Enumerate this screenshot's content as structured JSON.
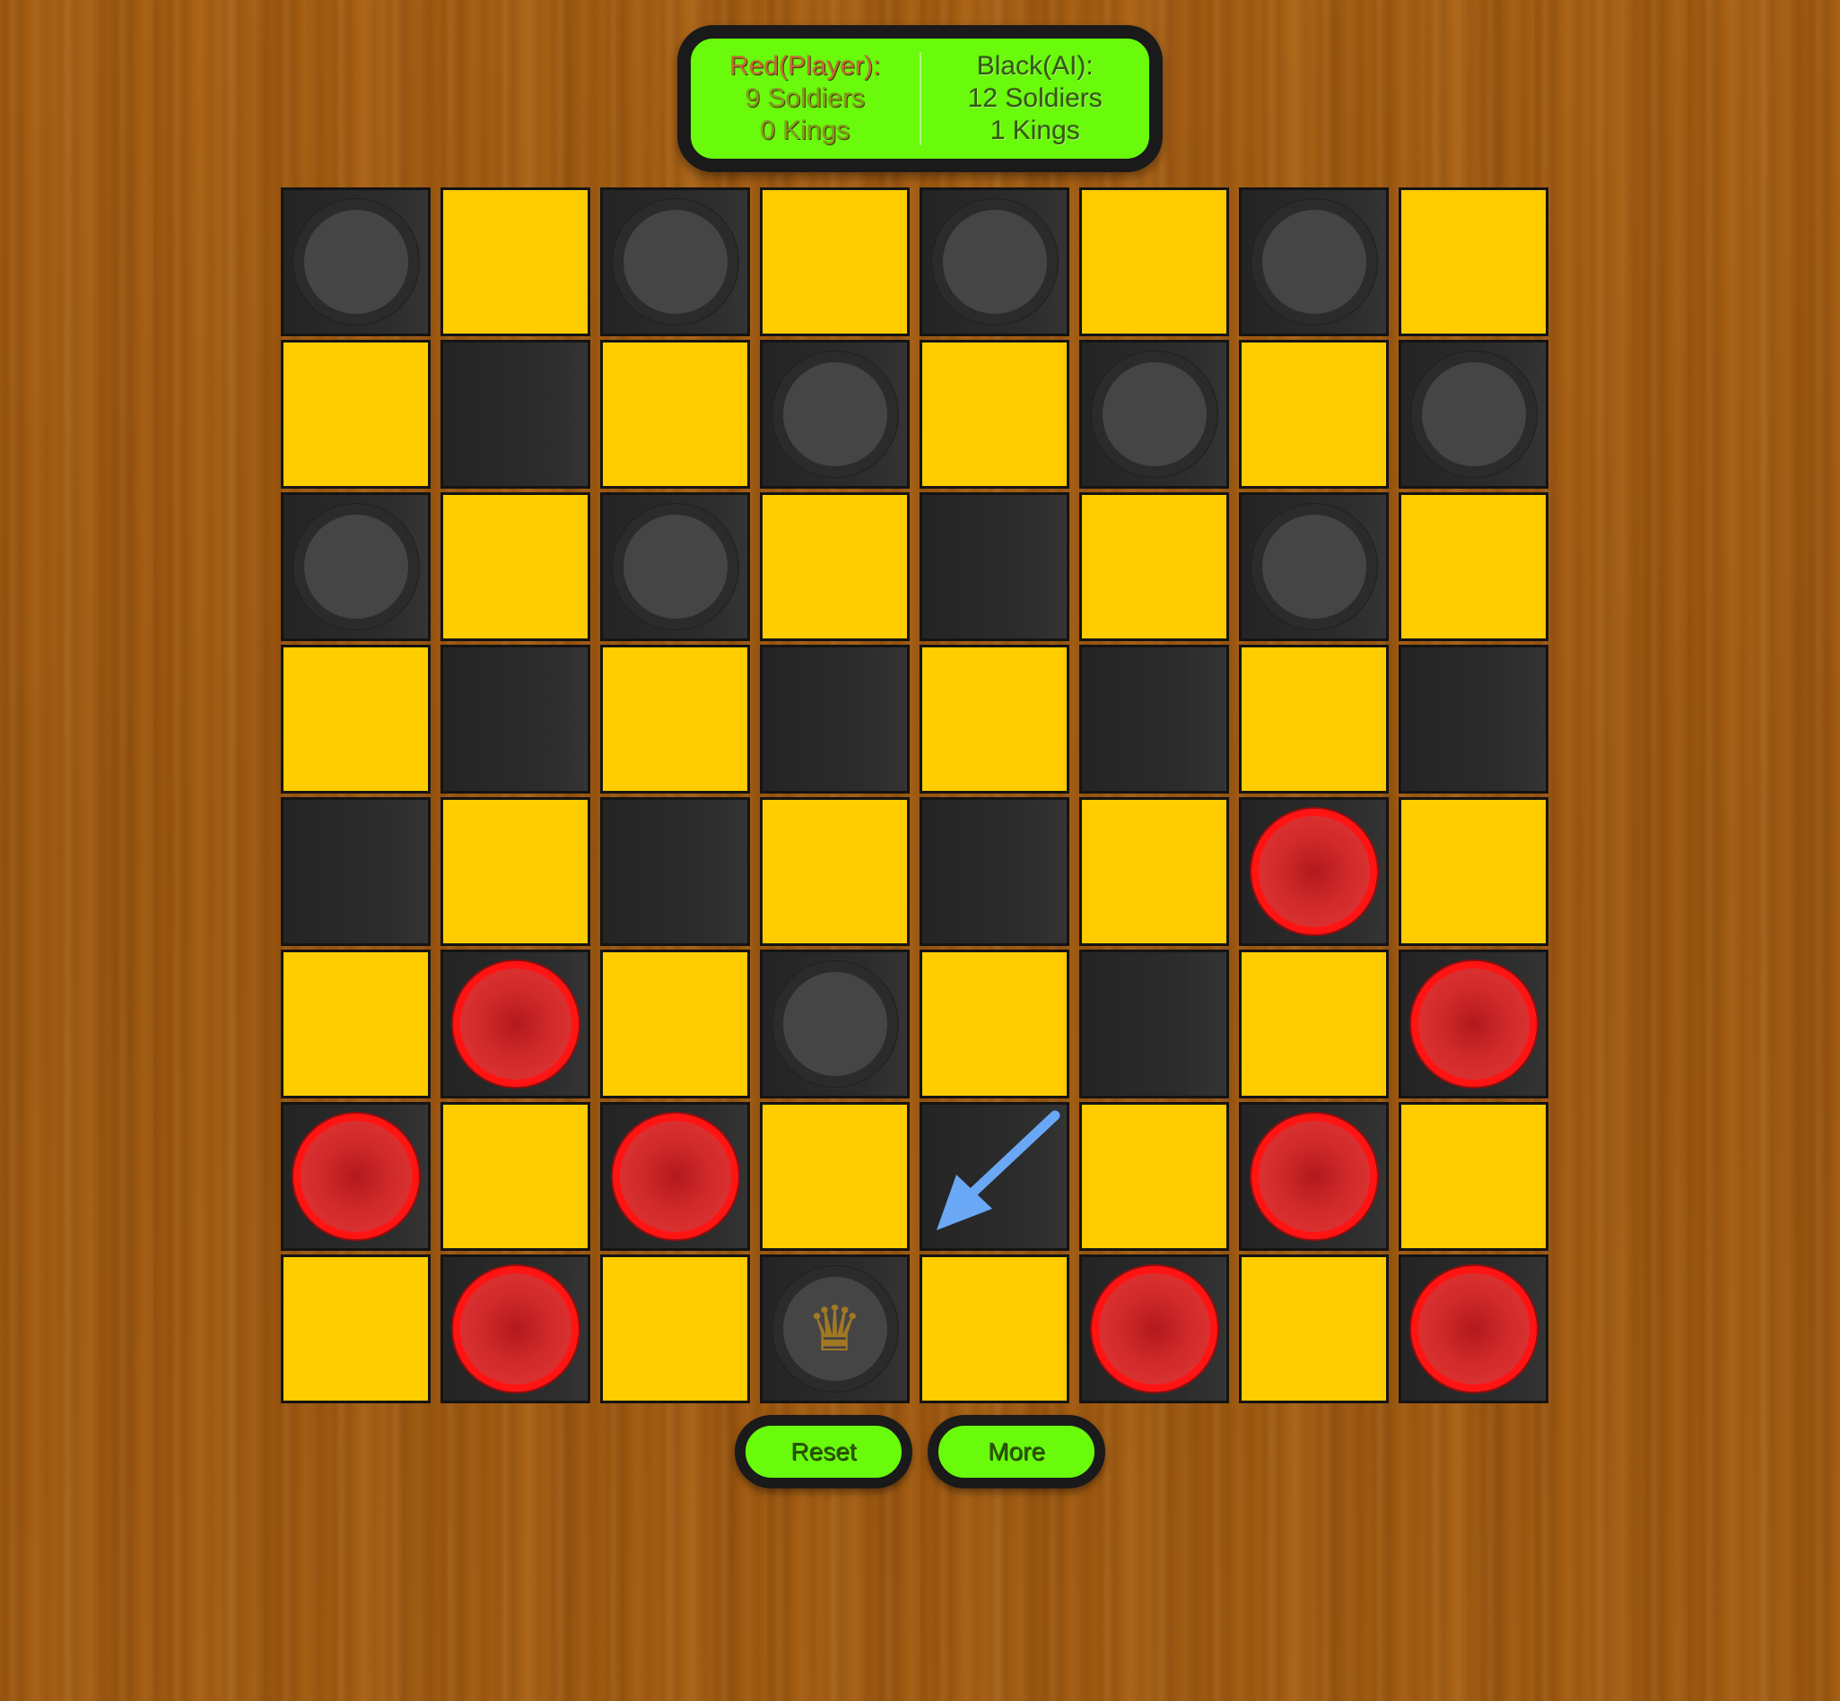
{
  "scoreboard": {
    "red": {
      "title": "Red(Player):",
      "soldiers": "9 Soldiers",
      "kings": "0 Kings"
    },
    "black": {
      "title": "Black(AI):",
      "soldiers": "12 Soldiers",
      "kings": "1 Kings"
    }
  },
  "board": {
    "rows": 8,
    "cols": 8,
    "light_color": "#ffcc00",
    "dark_color": "#2a2a2a",
    "pieces": [
      {
        "row": 0,
        "col": 0,
        "color": "black",
        "king": false
      },
      {
        "row": 0,
        "col": 2,
        "color": "black",
        "king": false
      },
      {
        "row": 0,
        "col": 4,
        "color": "black",
        "king": false
      },
      {
        "row": 0,
        "col": 6,
        "color": "black",
        "king": false
      },
      {
        "row": 1,
        "col": 3,
        "color": "black",
        "king": false
      },
      {
        "row": 1,
        "col": 5,
        "color": "black",
        "king": false
      },
      {
        "row": 1,
        "col": 7,
        "color": "black",
        "king": false
      },
      {
        "row": 2,
        "col": 0,
        "color": "black",
        "king": false
      },
      {
        "row": 2,
        "col": 2,
        "color": "black",
        "king": false
      },
      {
        "row": 2,
        "col": 6,
        "color": "black",
        "king": false
      },
      {
        "row": 4,
        "col": 6,
        "color": "red",
        "king": false
      },
      {
        "row": 5,
        "col": 1,
        "color": "red",
        "king": false
      },
      {
        "row": 5,
        "col": 3,
        "color": "black",
        "king": false
      },
      {
        "row": 5,
        "col": 7,
        "color": "red",
        "king": false
      },
      {
        "row": 6,
        "col": 0,
        "color": "red",
        "king": false
      },
      {
        "row": 6,
        "col": 2,
        "color": "red",
        "king": false
      },
      {
        "row": 6,
        "col": 6,
        "color": "red",
        "king": false
      },
      {
        "row": 7,
        "col": 1,
        "color": "red",
        "king": false
      },
      {
        "row": 7,
        "col": 3,
        "color": "black",
        "king": true
      },
      {
        "row": 7,
        "col": 5,
        "color": "red",
        "king": false
      },
      {
        "row": 7,
        "col": 7,
        "color": "red",
        "king": false
      }
    ],
    "last_move_arrow": {
      "from": {
        "row": 6,
        "col": 4
      },
      "direction": "down-left",
      "color": "#6aa8f5"
    }
  },
  "controls": {
    "reset_label": "Reset",
    "more_label": "More"
  },
  "colors": {
    "panel_green": "#69fb0b",
    "red_piece": "#d62828",
    "black_piece": "#454545"
  }
}
